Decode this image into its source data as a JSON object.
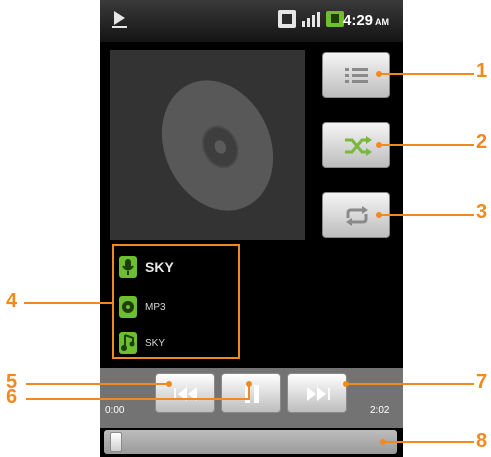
{
  "status_bar": {
    "time": "4:29",
    "ampm": "AM",
    "icons": [
      "music-playing-icon",
      "data-icon",
      "signal-icon",
      "message-icon"
    ]
  },
  "album_art": {
    "icon": "cd-disc-icon"
  },
  "side_buttons": [
    {
      "name": "playlist-button",
      "icon": "playlist-icon"
    },
    {
      "name": "shuffle-button",
      "icon": "shuffle-icon"
    },
    {
      "name": "repeat-button",
      "icon": "repeat-icon"
    }
  ],
  "track_info": {
    "title": "SKY",
    "format": "MP3",
    "artist": "SKY"
  },
  "playback": {
    "elapsed": "0:00",
    "duration": "2:02",
    "progress": 0.0
  },
  "callouts": [
    "1",
    "2",
    "3",
    "4",
    "5",
    "6",
    "7",
    "8"
  ],
  "colors": {
    "accent": "#f08a1e",
    "green": "#6cbf2e"
  }
}
